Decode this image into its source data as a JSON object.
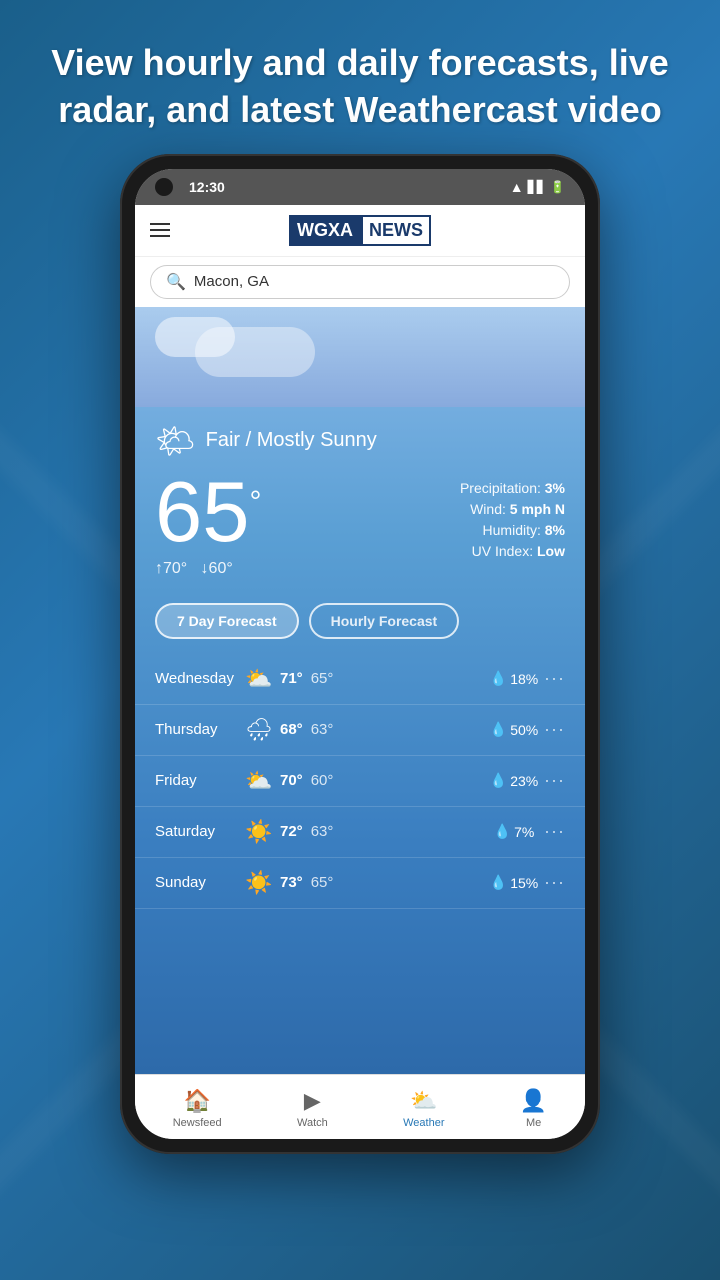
{
  "headline": "View hourly and daily forecasts, live radar, and latest Weathercast video",
  "status": {
    "time": "12:30"
  },
  "logo": {
    "wgxa": "WGXA",
    "news": "NEWS"
  },
  "search": {
    "placeholder": "Macon, GA",
    "value": "Macon, GA"
  },
  "weather": {
    "condition": "Fair / Mostly Sunny",
    "temperature": "65",
    "high": "70°",
    "low": "60°",
    "precipitation": "3%",
    "wind": "5 mph N",
    "humidity": "8%",
    "uvIndex": "Low"
  },
  "tabs": {
    "sevenDay": "7 Day Forecast",
    "hourly": "Hourly Forecast"
  },
  "forecast": [
    {
      "day": "Wednesday",
      "icon": "⛅",
      "high": "71°",
      "low": "65°",
      "precip": "18%",
      "precipIcon": "💧"
    },
    {
      "day": "Thursday",
      "icon": "🌧",
      "high": "68°",
      "low": "63°",
      "precip": "50%",
      "precipIcon": "💧"
    },
    {
      "day": "Friday",
      "icon": "⛅",
      "high": "70°",
      "low": "60°",
      "precip": "23%",
      "precipIcon": "💧"
    },
    {
      "day": "Saturday",
      "icon": "☀️",
      "high": "72°",
      "low": "63°",
      "precip": "7%",
      "precipIcon": "💧"
    },
    {
      "day": "Sunday",
      "icon": "☀️",
      "high": "73°",
      "low": "65°",
      "precip": "15%",
      "precipIcon": "💧"
    }
  ],
  "bottomNav": [
    {
      "id": "newsfeed",
      "label": "Newsfeed",
      "icon": "🏠",
      "active": false
    },
    {
      "id": "watch",
      "label": "Watch",
      "icon": "▶",
      "active": false
    },
    {
      "id": "weather",
      "label": "Weather",
      "icon": "⛅",
      "active": true
    },
    {
      "id": "me",
      "label": "Me",
      "icon": "👤",
      "active": false
    }
  ]
}
